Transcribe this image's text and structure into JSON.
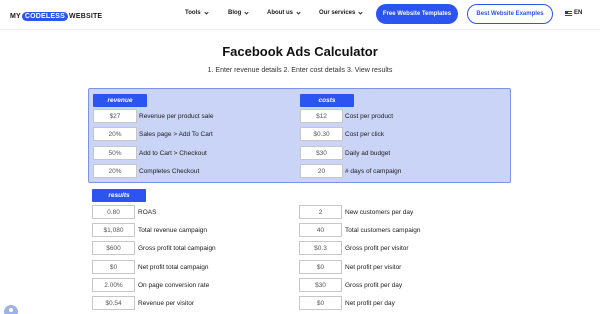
{
  "header": {
    "logo": {
      "before": "MY",
      "pill": "CODELESS",
      "after": "WEBSITE"
    },
    "nav": [
      "Tools",
      "Blog",
      "About us",
      "Our services"
    ],
    "cta_primary": "Free Website Templates",
    "cta_secondary": "Best Website Examples",
    "language": "EN"
  },
  "page": {
    "title": "Facebook Ads Calculator",
    "subtitle": "1. Enter revenue details 2. Enter cost details 3. View results"
  },
  "revenue": {
    "tag": "revenue",
    "rows": [
      {
        "value": "$27",
        "label": "Revenue per product sale"
      },
      {
        "value": "20%",
        "label": "Sales page > Add To Cart"
      },
      {
        "value": "50%",
        "label": "Add to Cart > Checkout"
      },
      {
        "value": "20%",
        "label": "Completes Checkout"
      }
    ]
  },
  "costs": {
    "tag": "costs",
    "rows": [
      {
        "value": "$12",
        "label": "Cost per product"
      },
      {
        "value": "$0.30",
        "label": "Cost per click"
      },
      {
        "value": "$30",
        "label": "Daily ad budget"
      },
      {
        "value": "20",
        "label": "# days of campaign"
      }
    ]
  },
  "results": {
    "tag": "results",
    "left": [
      {
        "value": "0.80",
        "label": "ROAS"
      },
      {
        "value": "$1,080",
        "label": "Total revenue campaign"
      },
      {
        "value": "$600",
        "label": "Gross profit total campaign"
      },
      {
        "value": "$0",
        "label": "Net profit total campaign"
      },
      {
        "value": "2.00%",
        "label": "On page conversion rate"
      },
      {
        "value": "$0.54",
        "label": "Revenue per visitor"
      }
    ],
    "right": [
      {
        "value": "2",
        "label": "New customers per day"
      },
      {
        "value": "40",
        "label": "Total customers campaign"
      },
      {
        "value": "$0.3",
        "label": "Gross profit per visitor"
      },
      {
        "value": "$0",
        "label": "Net profit per visitor"
      },
      {
        "value": "$30",
        "label": "Gross profit per day"
      },
      {
        "value": "$0",
        "label": "Net profit per day"
      }
    ]
  },
  "colors": {
    "accent": "#2b54f0",
    "panel_bg": "#c9d4f7",
    "panel_border": "#7c93e6"
  }
}
